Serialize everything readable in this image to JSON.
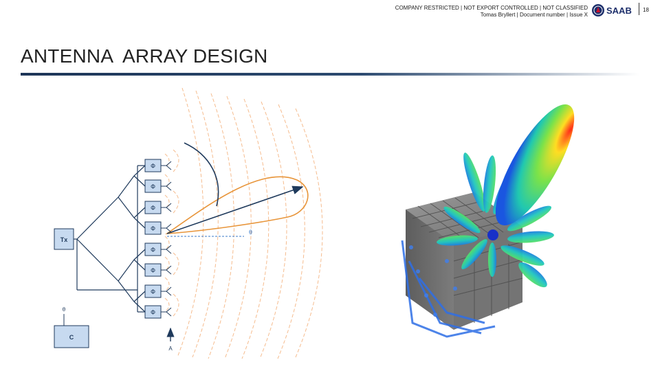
{
  "header": {
    "classification": "COMPANY RESTRICTED | NOT EXPORT CONTROLLED | NOT CLASSIFIED",
    "author_line": "Tomas Bryllert | Document number | Issue X",
    "logo_text": "SAAB",
    "page_number": "18"
  },
  "slide": {
    "title": "ANTENNA  ARRAY DESIGN"
  },
  "diagram": {
    "transmitter_label": "Tx",
    "controller_label": "C",
    "theta_label": "θ",
    "beam_angle_label": "θ",
    "axis_label": "A",
    "phase_shifter_label": "Φ",
    "phase_shifters": [
      "Φ",
      "Φ",
      "Φ",
      "Φ",
      "Φ",
      "Φ",
      "Φ",
      "Φ"
    ]
  },
  "colors": {
    "line": "#1f3a5c",
    "wavefront": "#f0a060",
    "title_rule": "#1d3557"
  }
}
